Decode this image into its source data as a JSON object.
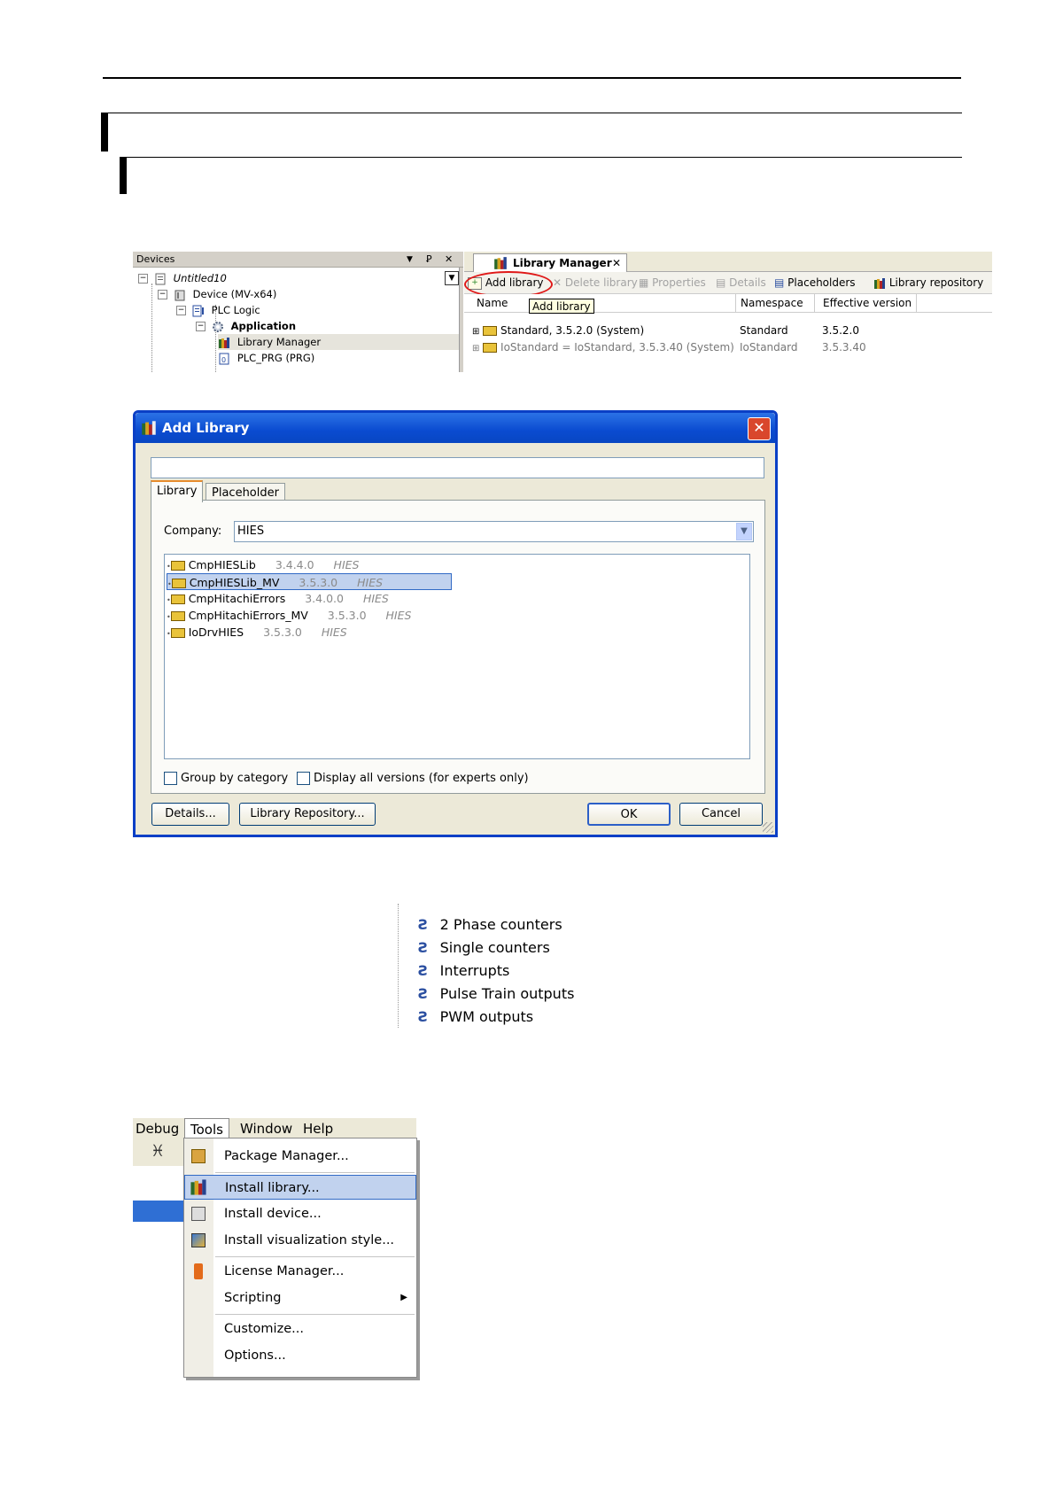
{
  "colors": {
    "xp_blue": "#0a3fc6",
    "select_blue": "#c1d2ee",
    "highlight_circle": "#e01818"
  },
  "panel1": {
    "devices": {
      "header": "Devices",
      "icons": [
        "dropdown-arrow",
        "pin-icon",
        "close-icon"
      ],
      "tree": [
        {
          "label": "Untitled10"
        },
        {
          "label": "Device (MV-x64)"
        },
        {
          "label": "PLC Logic"
        },
        {
          "label": "Application"
        },
        {
          "label": "Library Manager"
        },
        {
          "label": "PLC_PRG (PRG)"
        }
      ]
    },
    "libman": {
      "tab_label": "Library Manager",
      "toolbar": {
        "add": "Add library",
        "delete": "Delete library",
        "properties": "Properties",
        "details": "Details",
        "placeholders": "Placeholders",
        "repository": "Library repository"
      },
      "tooltip": "Add library",
      "columns": {
        "name": "Name",
        "namespace": "Namespace",
        "effective": "Effective version"
      },
      "rows": [
        {
          "name": "Standard, 3.5.2.0 (System)",
          "namespace": "Standard",
          "version": "3.5.2.0"
        },
        {
          "name": "IoStandard = IoStandard, 3.5.3.40 (System)",
          "namespace": "IoStandard",
          "version": "3.5.3.40"
        }
      ]
    }
  },
  "dialog": {
    "title": "Add Library",
    "search_value": "",
    "tabs": {
      "library": "Library",
      "placeholder": "Placeholder"
    },
    "company_label": "Company:",
    "company_value": "HIES",
    "libraries": [
      {
        "name": "CmpHIESLib",
        "version": "3.4.4.0",
        "company": "HIES"
      },
      {
        "name": "CmpHIESLib_MV",
        "version": "3.5.3.0",
        "company": "HIES"
      },
      {
        "name": "CmpHitachiErrors",
        "version": "3.4.0.0",
        "company": "HIES"
      },
      {
        "name": "CmpHitachiErrors_MV",
        "version": "3.5.3.0",
        "company": "HIES"
      },
      {
        "name": "IoDrvHIES",
        "version": "3.5.3.0",
        "company": "HIES"
      }
    ],
    "group_by_category": "Group by category",
    "display_all": "Display all versions (for experts only)",
    "buttons": {
      "details": "Details...",
      "repository": "Library Repository...",
      "ok": "OK",
      "cancel": "Cancel"
    }
  },
  "counters": [
    "2 Phase counters",
    "Single counters",
    "Interrupts",
    "Pulse Train outputs",
    "PWM outputs"
  ],
  "menu": {
    "bar": [
      "Debug",
      "Tools",
      "Window",
      "Help"
    ],
    "items": [
      {
        "label": "Package Manager...",
        "icon": "package-icon"
      },
      {
        "label": "Install library...",
        "icon": "library-icon"
      },
      {
        "label": "Install device...",
        "icon": "device-icon"
      },
      {
        "label": "Install visualization style...",
        "icon": "visualization-icon"
      },
      {
        "label": "License Manager...",
        "icon": "license-icon"
      },
      {
        "label": "Scripting",
        "icon": ""
      },
      {
        "label": "Customize...",
        "icon": ""
      },
      {
        "label": "Options...",
        "icon": ""
      }
    ]
  }
}
